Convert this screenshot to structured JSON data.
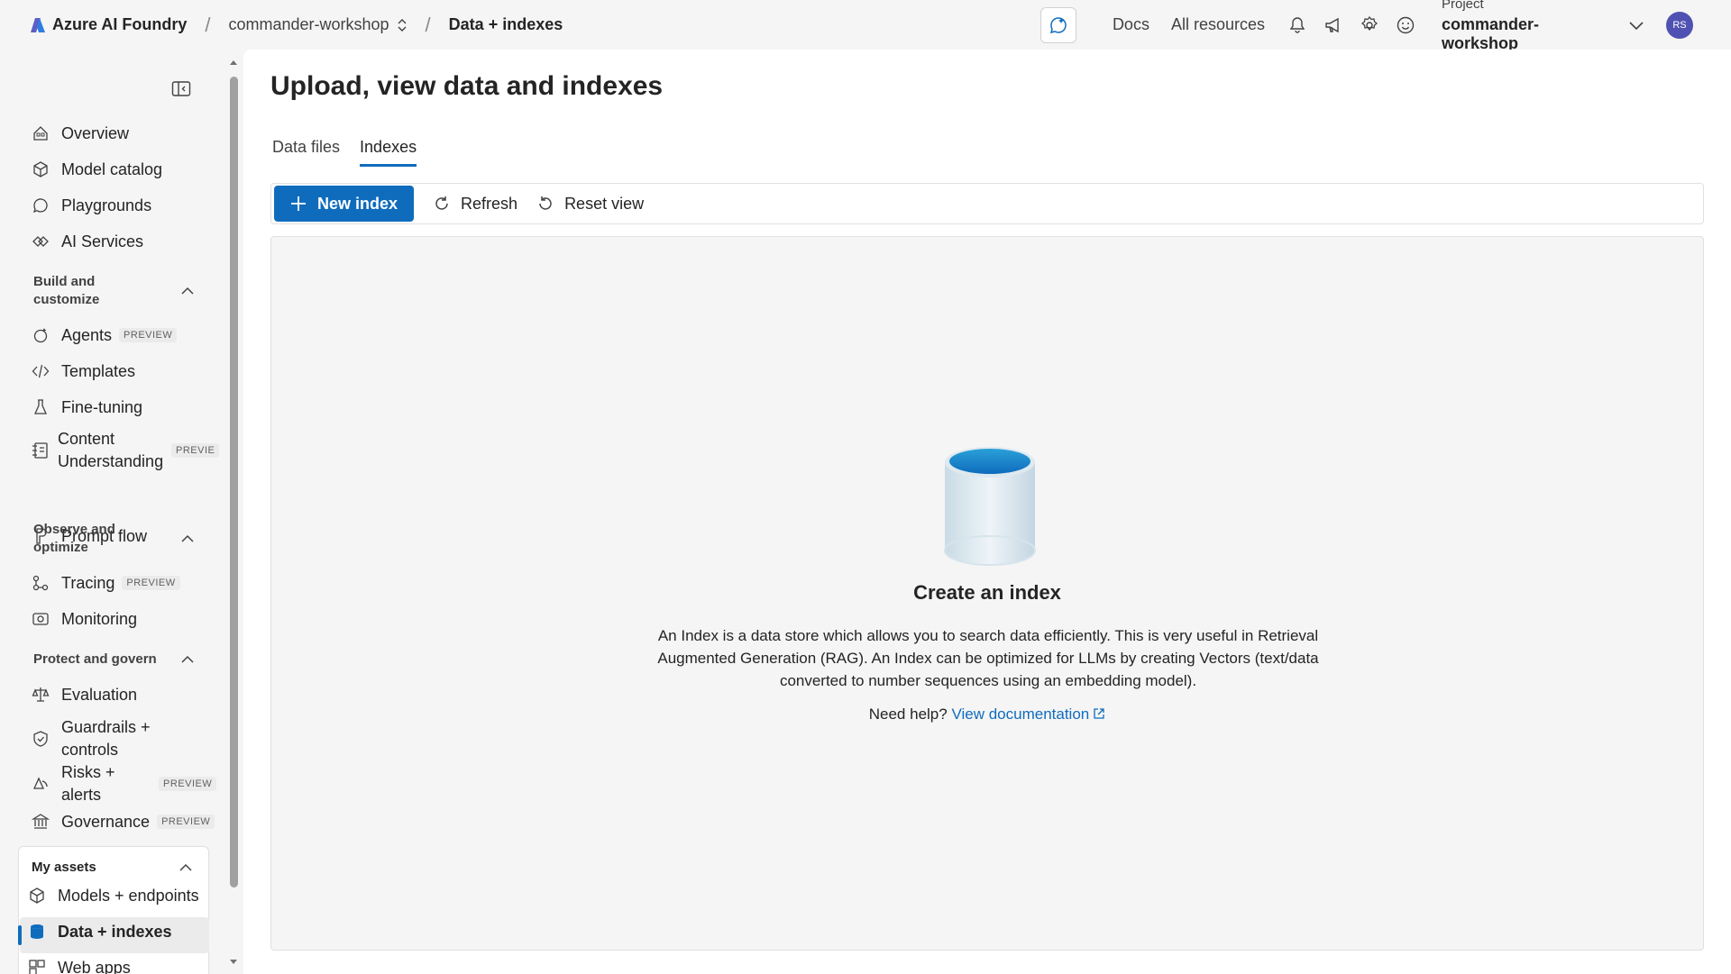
{
  "brand": {
    "name": "Azure AI Foundry"
  },
  "breadcrumb": {
    "project": "commander-workshop",
    "current": "Data + indexes"
  },
  "header": {
    "docs": "Docs",
    "all_resources": "All resources",
    "project_label": "Project",
    "project_name": "commander-workshop",
    "avatar_initials": "RS"
  },
  "sidebar": {
    "top_items": [
      {
        "label": "Overview",
        "icon": "overview-icon"
      },
      {
        "label": "Model catalog",
        "icon": "cube-icon"
      },
      {
        "label": "Playgrounds",
        "icon": "chat-icon"
      },
      {
        "label": "AI Services",
        "icon": "services-icon"
      }
    ],
    "build_section": "Build and customize",
    "build_items": [
      {
        "label": "Agents",
        "badge": "PREVIEW"
      },
      {
        "label": "Templates"
      },
      {
        "label": "Fine-tuning"
      },
      {
        "label": "Content Understanding",
        "badge": "PREVIE"
      },
      {
        "label": "Prompt flow"
      }
    ],
    "observe_section": "Observe and optimize",
    "observe_items": [
      {
        "label": "Tracing",
        "badge": "PREVIEW"
      },
      {
        "label": "Monitoring"
      }
    ],
    "protect_section": "Protect and govern",
    "protect_items": [
      {
        "label": "Evaluation"
      },
      {
        "label": "Guardrails + controls"
      },
      {
        "label": "Risks + alerts",
        "badge": "PREVIEW"
      },
      {
        "label": "Governance",
        "badge": "PREVIEW"
      }
    ],
    "assets_section": "My assets",
    "assets_items": [
      {
        "label": "Models + endpoints"
      },
      {
        "label": "Data + indexes"
      },
      {
        "label": "Web apps"
      }
    ]
  },
  "main": {
    "title": "Upload, view data and indexes",
    "tabs": [
      "Data files",
      "Indexes"
    ],
    "active_tab": "Indexes",
    "toolbar": {
      "new_index": "New index",
      "refresh": "Refresh",
      "reset_view": "Reset view"
    },
    "empty": {
      "title": "Create an index",
      "description": "An Index is a data store which allows you to search data efficiently. This is very useful in Retrieval Augmented Generation (RAG). An Index can be optimized for LLMs by creating Vectors (text/data converted to number sequences using an embedding model).",
      "help_prefix": "Need help?",
      "help_link": "View documentation"
    }
  },
  "colors": {
    "accent": "#0f6cbd",
    "background": "#f5f5f5",
    "panel": "#ffffff"
  }
}
